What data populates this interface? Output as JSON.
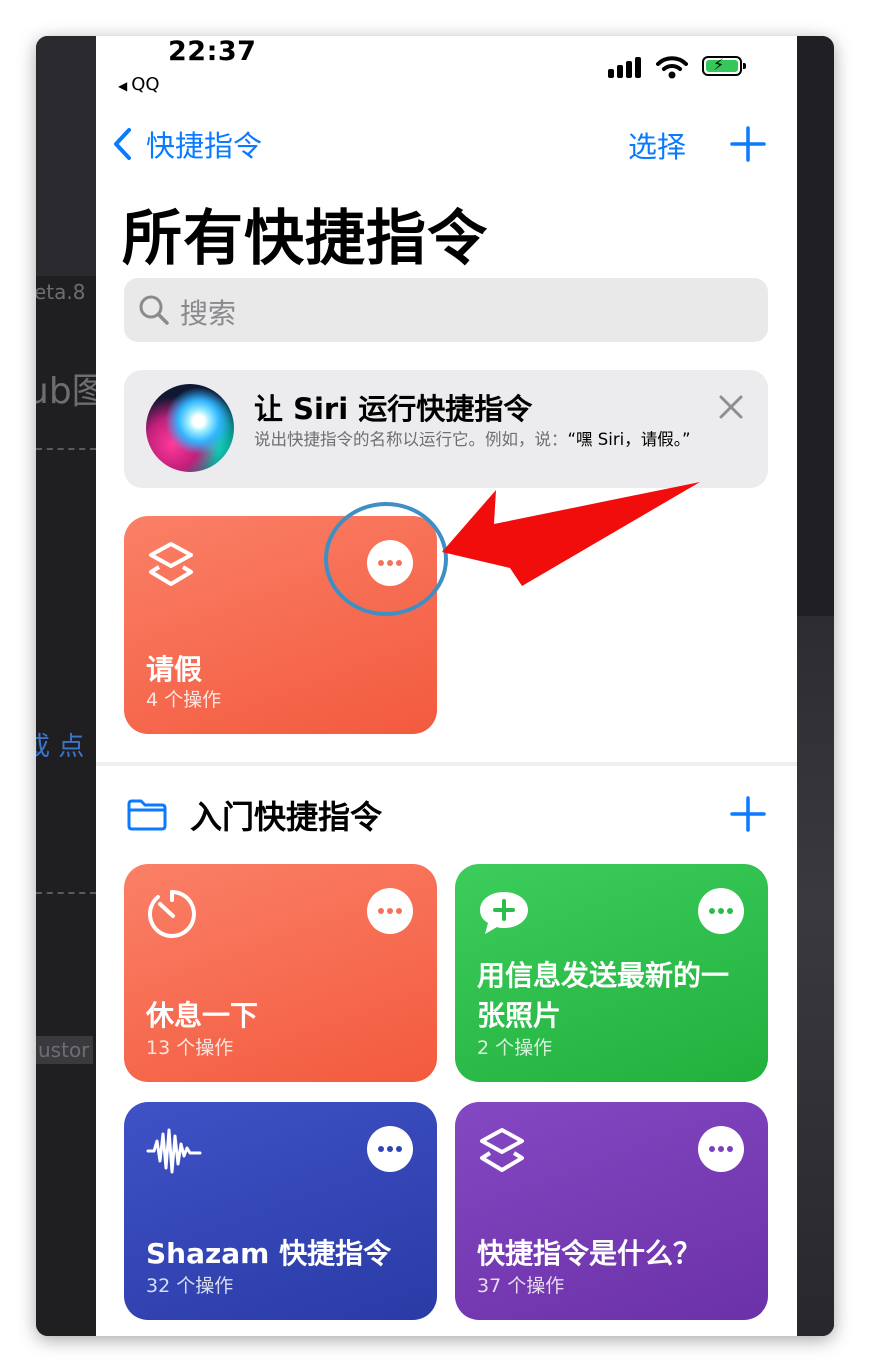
{
  "status_bar": {
    "time": "22:37",
    "back_app": "QQ"
  },
  "background": {
    "text_1": "eta.8",
    "text_2": "ub图",
    "text_3": "或 点",
    "text_4": "ustor"
  },
  "nav": {
    "back_label": "快捷指令",
    "select_label": "选择"
  },
  "page_title": "所有快捷指令",
  "search": {
    "placeholder": "搜索"
  },
  "siri_banner": {
    "title": "让 Siri 运行快捷指令",
    "description": "说出快捷指令的名称以运行它。例如，说：",
    "example": "“嘿 Siri，请假。”"
  },
  "shortcut": {
    "name": "请假",
    "count": "4 个操作",
    "color": "#f7715a"
  },
  "folder": {
    "name": "入门快捷指令"
  },
  "folder_cards": [
    {
      "name": "休息一下",
      "count": "13 个操作",
      "color": "#f7715a",
      "icon": "timer-icon"
    },
    {
      "name": "用信息发送最新的一张照片",
      "count": "2 个操作",
      "color": "#34c759",
      "icon": "message-plus-icon"
    },
    {
      "name": "Shazam 快捷指令",
      "count": "32 个操作",
      "color": "#2f45b5",
      "icon": "waveform-icon"
    },
    {
      "name": "快捷指令是什么？",
      "count": "37 个操作",
      "color": "#7a41b8",
      "icon": "shortcuts-icon"
    }
  ],
  "colors": {
    "accent": "#0a7aff",
    "annotation_circle": "#3d8fc4",
    "annotation_arrow": "#f20d0d"
  }
}
